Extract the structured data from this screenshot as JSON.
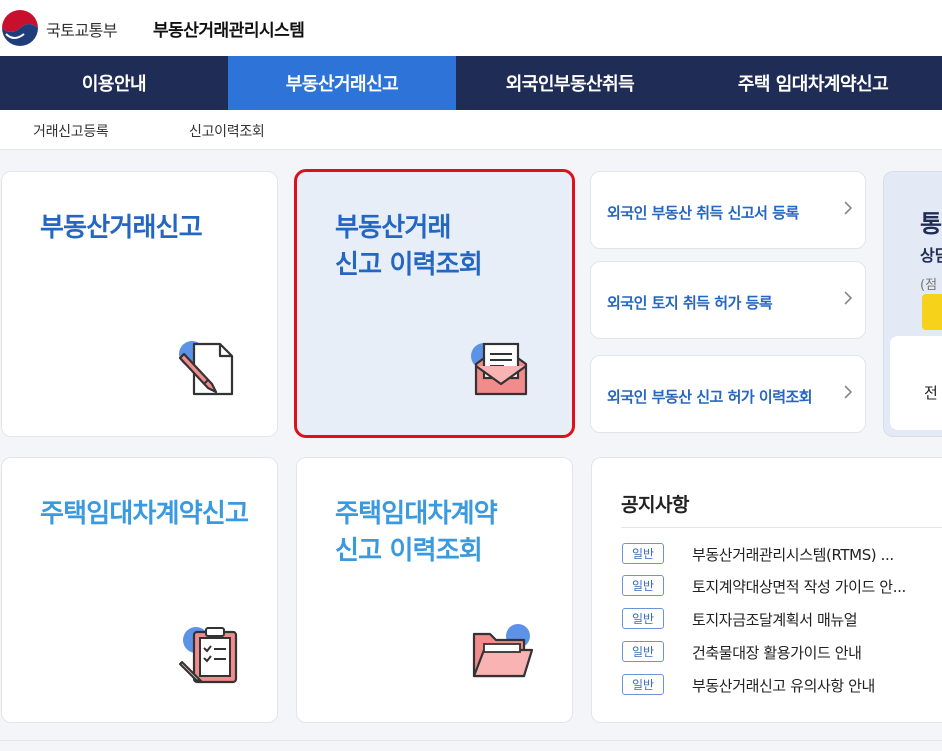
{
  "header": {
    "ministry": "국토교통부",
    "system_title": "부동산거래관리시스템"
  },
  "gnb": [
    {
      "label": "이용안내"
    },
    {
      "label": "부동산거래신고"
    },
    {
      "label": "외국인부동산취득"
    },
    {
      "label": "주택 임대차계약신고"
    }
  ],
  "lnb": [
    {
      "label": "거래신고등록"
    },
    {
      "label": "신고이력조회"
    }
  ],
  "cards": {
    "report": {
      "title": "부동산거래신고",
      "icon": "pen-document-icon"
    },
    "history": {
      "title_line1": "부동산거래",
      "title_line2": "신고 이력조회",
      "icon": "envelope-letter-icon"
    },
    "lease": {
      "title": "주택임대차계약신고",
      "icon": "clipboard-checklist-icon"
    },
    "lease_history": {
      "title_line1": "주택임대차계약",
      "title_line2": "신고 이력조회",
      "icon": "folder-icon"
    }
  },
  "links": [
    {
      "label": "외국인 부동산 취득 신고서 등록"
    },
    {
      "label": "외국인 토지 취득 허가 등록"
    },
    {
      "label": "외국인 부동산 신고 허가 이력조회"
    }
  ],
  "side": {
    "title": "통",
    "sub": "상담",
    "note": "(점",
    "inner": "전"
  },
  "notice": {
    "title": "공지사항",
    "items": [
      {
        "badge": "일반",
        "text": "부동산거래관리시스템(RTMS) ..."
      },
      {
        "badge": "일반",
        "text": "토지계약대상면적 작성 가이드 안..."
      },
      {
        "badge": "일반",
        "text": "토지자금조달계획서 매뉴얼"
      },
      {
        "badge": "일반",
        "text": "건축물대장 활용가이드 안내"
      },
      {
        "badge": "일반",
        "text": "부동산거래신고 유의사항 안내"
      }
    ]
  },
  "colors": {
    "nav_bg": "#1f2c55",
    "nav_active": "#2e74d8",
    "title_blue": "#2467c2",
    "title_light_blue": "#3a9ae0",
    "highlight_border": "#e0101a"
  }
}
